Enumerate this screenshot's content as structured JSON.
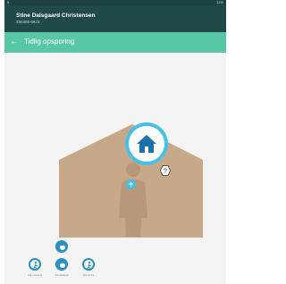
{
  "status_bar": {
    "left": "5",
    "right": "11%"
  },
  "header": {
    "user_name": "Stine Dalsgaard Christensen",
    "user_id": "250405-0672"
  },
  "toolbar": {
    "back_icon": "arrow-left-icon",
    "title": "Tidlig opsporing"
  },
  "colors": {
    "header_bg": "#1f4a47",
    "toolbar_bg": "#57c7a6",
    "accent_blue": "#46c1e5",
    "house_color": "#c7a98a",
    "button_blue": "#2a8fc1"
  },
  "icons": {
    "home": "home-icon",
    "help": "help-icon",
    "add": "plus-icon",
    "brain": "brain-icon",
    "walking": "walking-person-icon"
  },
  "bottom_buttons": [
    {
      "label": "Gå i tilstand",
      "icon": "walking-person-icon"
    },
    {
      "label": "Bevidsthed",
      "icon": "brain-icon"
    },
    {
      "label": "Gå ud fra",
      "icon": "walking-person-icon"
    }
  ],
  "top_bottom_button": {
    "icon": "brain-icon"
  },
  "add_label": "+",
  "help_label": "?"
}
